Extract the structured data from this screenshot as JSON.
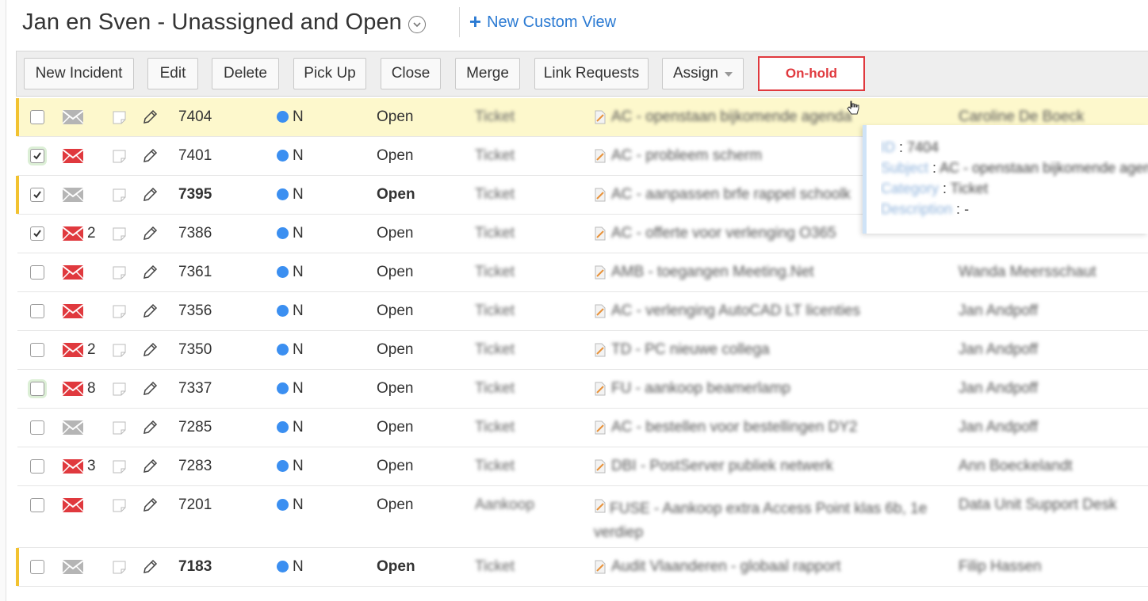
{
  "header": {
    "title": "Jan en Sven - Unassigned and Open",
    "new_view_label": "New Custom View"
  },
  "toolbar": {
    "new_incident": "New Incident",
    "edit": "Edit",
    "delete": "Delete",
    "pick_up": "Pick Up",
    "close": "Close",
    "merge": "Merge",
    "link_requests": "Link Requests",
    "assign": "Assign",
    "on_hold": "On-hold"
  },
  "colors": {
    "accent": "#2c7bd3",
    "highlight": "#fdf8cc",
    "on_hold": "#e0393e",
    "priority_dot": "#3b8ff1",
    "mail_unread": "#e0393e",
    "mail_read": "#b5b5b5"
  },
  "rows": [
    {
      "id": "7404",
      "checked": false,
      "mail": "read",
      "count": "",
      "priority": "N",
      "status": "Open",
      "category": "Ticket",
      "subject": "AC - openstaan bijkomende agenda",
      "requester": "Caroline De Boeck",
      "bold": false
    },
    {
      "id": "7401",
      "checked": true,
      "mail": "unread",
      "count": "",
      "priority": "N",
      "status": "Open",
      "category": "Ticket",
      "subject": "AC - probleem scherm",
      "requester": "",
      "bold": false
    },
    {
      "id": "7395",
      "checked": true,
      "mail": "read",
      "count": "",
      "priority": "N",
      "status": "Open",
      "category": "Ticket",
      "subject": "AC - aanpassen brfe rappel schoolk",
      "requester": "",
      "bold": true
    },
    {
      "id": "7386",
      "checked": true,
      "mail": "unread",
      "count": "2",
      "priority": "N",
      "status": "Open",
      "category": "Ticket",
      "subject": "AC - offerte voor verlenging O365",
      "requester": "",
      "bold": false
    },
    {
      "id": "7361",
      "checked": false,
      "mail": "unread",
      "count": "",
      "priority": "N",
      "status": "Open",
      "category": "Ticket",
      "subject": "AMB - toegangen Meeting.Net",
      "requester": "Wanda Meersschaut",
      "bold": false
    },
    {
      "id": "7356",
      "checked": false,
      "mail": "unread",
      "count": "",
      "priority": "N",
      "status": "Open",
      "category": "Ticket",
      "subject": "AC - verlenging AutoCAD LT licenties",
      "requester": "Jan Andpoff",
      "bold": false
    },
    {
      "id": "7350",
      "checked": false,
      "mail": "unread",
      "count": "2",
      "priority": "N",
      "status": "Open",
      "category": "Ticket",
      "subject": "TD - PC nieuwe collega",
      "requester": "Jan Andpoff",
      "bold": false
    },
    {
      "id": "7337",
      "checked": false,
      "mail": "unread",
      "count": "8",
      "priority": "N",
      "status": "Open",
      "category": "Ticket",
      "subject": "FU - aankoop beamerlamp",
      "requester": "Jan Andpoff",
      "bold": false
    },
    {
      "id": "7285",
      "checked": false,
      "mail": "read",
      "count": "",
      "priority": "N",
      "status": "Open",
      "category": "Ticket",
      "subject": "AC - bestellen voor bestellingen DY2",
      "requester": "Jan Andpoff",
      "bold": false
    },
    {
      "id": "7283",
      "checked": false,
      "mail": "unread",
      "count": "3",
      "priority": "N",
      "status": "Open",
      "category": "Ticket",
      "subject": "DBI - PostServer publiek netwerk",
      "requester": "Ann Boeckelandt",
      "bold": false
    },
    {
      "id": "7201",
      "checked": false,
      "mail": "unread",
      "count": "",
      "priority": "N",
      "status": "Open",
      "category": "Aankoop",
      "subject": "FUSE - Aankoop extra Access Point klas 6b, 1e",
      "subject_line2": "verdiep",
      "requester": "Data Unit Support Desk",
      "bold": false
    },
    {
      "id": "7183",
      "checked": false,
      "mail": "read",
      "count": "",
      "priority": "N",
      "status": "Open",
      "category": "Ticket",
      "subject": "Audit Vlaanderen - globaal rapport",
      "requester": "Filip Hassen",
      "bold": true
    }
  ],
  "tooltip": {
    "id_key": "ID",
    "id_val": "7404",
    "subject_key": "Subject",
    "subject_val": "AC - openstaan bijkomende agenda",
    "category_key": "Category",
    "category_val": "Ticket",
    "description_key": "Description",
    "description_val": "-"
  }
}
